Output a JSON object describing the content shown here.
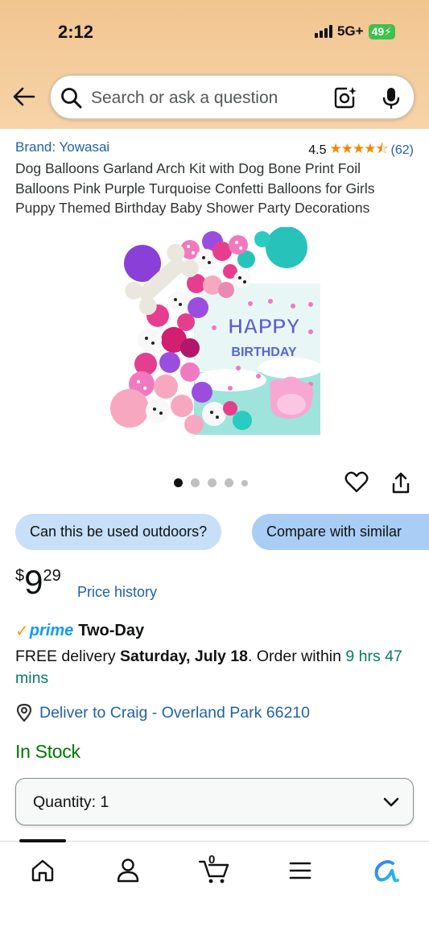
{
  "status_bar": {
    "time": "2:12",
    "network": "5G+",
    "battery": "49"
  },
  "search": {
    "placeholder": "Search or ask a question",
    "icons": [
      "back-arrow-icon",
      "search-icon",
      "camera-icon",
      "mic-icon"
    ]
  },
  "product": {
    "brand": "Brand: Yowasai",
    "rating": "4.5",
    "stars": 4.5,
    "review_count": "(62)",
    "title": "Dog Balloons Garland Arch Kit with Dog Bone Print Foil Balloons Pink Purple Turquoise Confetti Balloons for Girls Puppy Themed Birthday Baby Shower Party Decorations",
    "image_text": {
      "line1": "HAPPY",
      "line2": "BIRTHDAY"
    },
    "image_count": 5,
    "active_image": 1
  },
  "chips": [
    "Can this be used outdoors?",
    "Compare with similar"
  ],
  "price": {
    "currency": "$",
    "whole": "9",
    "fraction": "29",
    "history_label": "Price history"
  },
  "prime": {
    "check": "✓",
    "word": "prime",
    "label": "Two-Day"
  },
  "delivery": {
    "prefix": "FREE delivery ",
    "date": "Saturday, July 18",
    "middle": ". Order within ",
    "time": "9 hrs 47 mins"
  },
  "deliver_to": "Deliver to Craig - Overland Park 66210",
  "stock": "In Stock",
  "quantity": {
    "label": "Quantity: 1"
  },
  "tab_bar": {
    "cart_count": "0",
    "items": [
      "home-icon",
      "account-icon",
      "cart-icon",
      "menu-icon",
      "rufus-icon"
    ]
  },
  "colors": {
    "header": "#F2C590",
    "link": "#2162A1",
    "stock": "#007600",
    "prime": "#1399FF",
    "star": "#F08804"
  }
}
